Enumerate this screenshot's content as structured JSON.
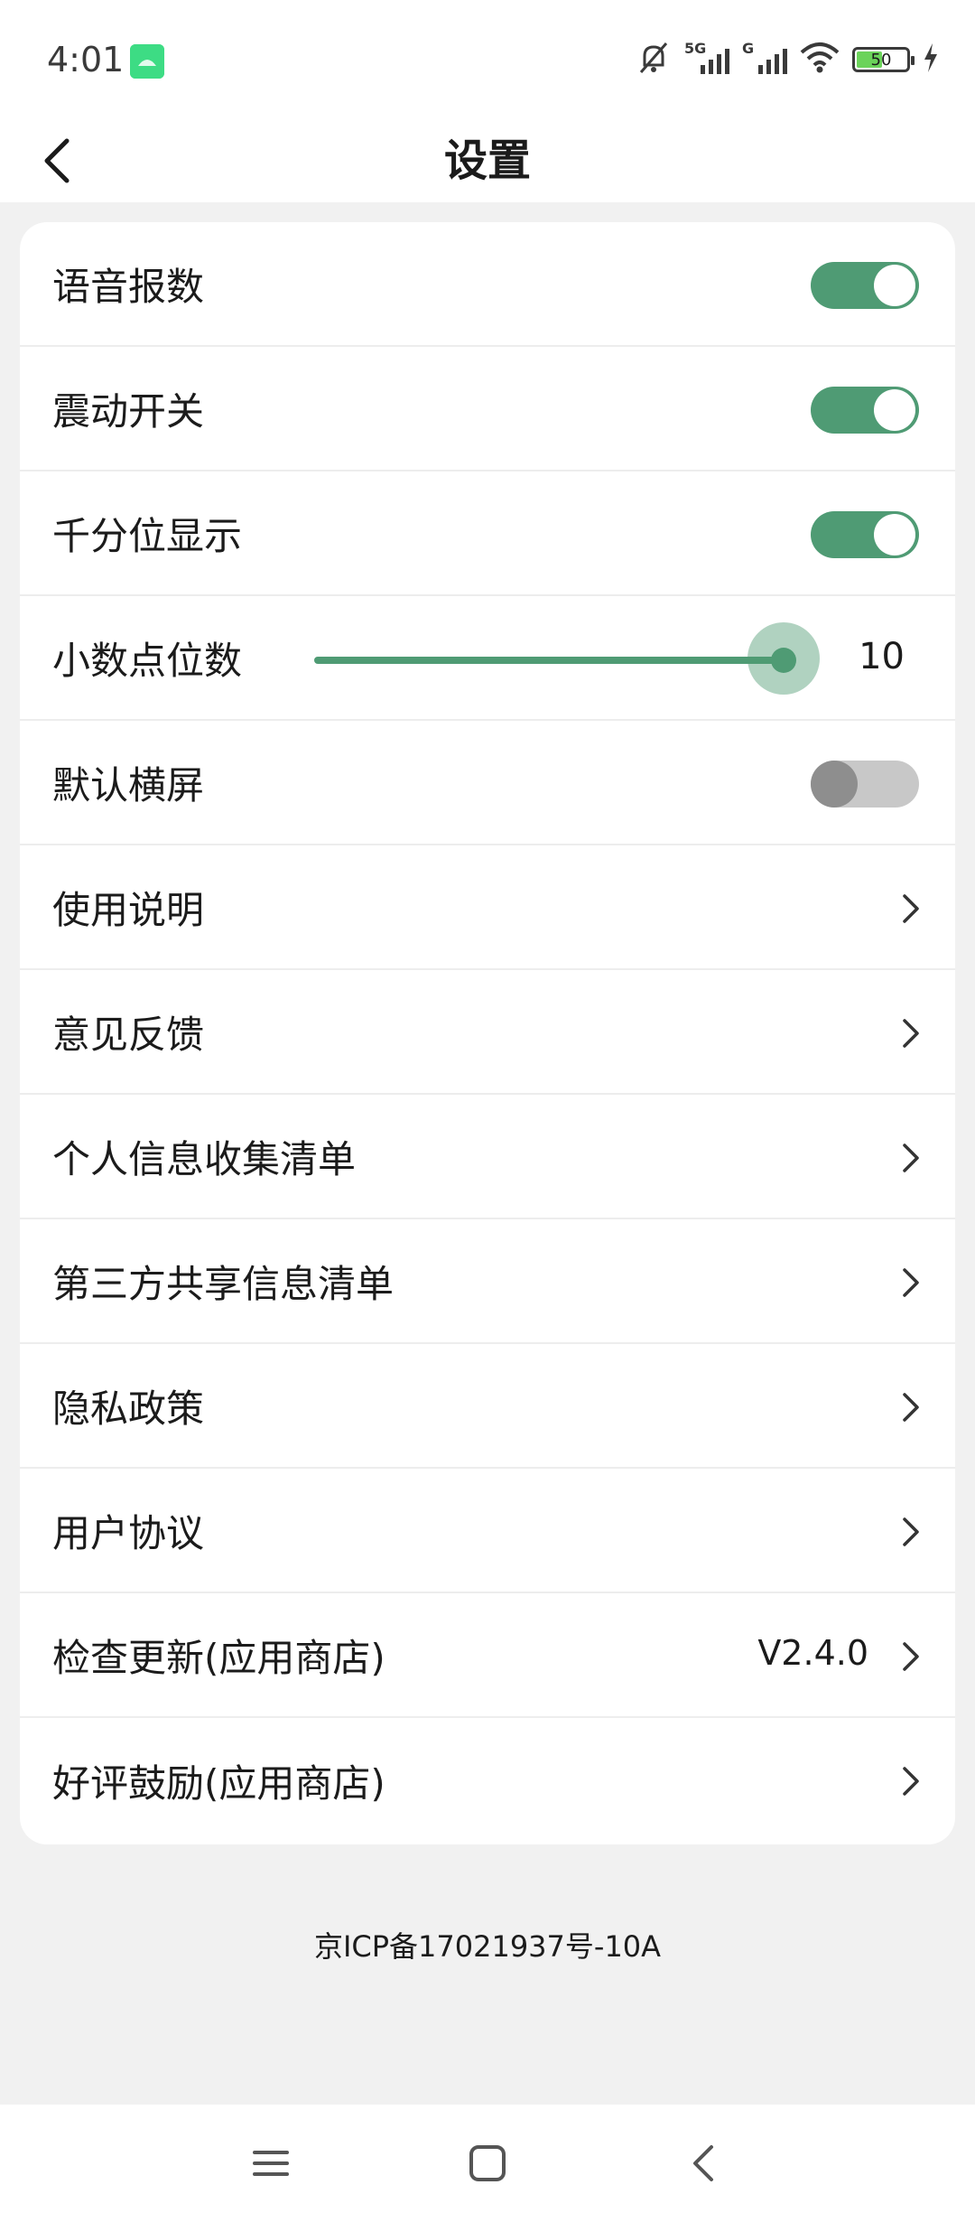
{
  "status_bar": {
    "time": "4:01",
    "signal_1_label": "5G",
    "signal_2_label": "G",
    "battery_level": "50",
    "icons": [
      "android-app-icon",
      "mute-icon",
      "signal-icon",
      "wifi-icon",
      "battery-icon",
      "charging-icon"
    ]
  },
  "header": {
    "title": "设置",
    "back_icon": "back-arrow-icon"
  },
  "settings": {
    "voice_broadcast": {
      "label": "语音报数",
      "on": true
    },
    "vibration": {
      "label": "震动开关",
      "on": true
    },
    "thousands_separator": {
      "label": "千分位显示",
      "on": true
    },
    "decimal_places": {
      "label": "小数点位数",
      "value": "10",
      "slider_fraction": 1.0
    },
    "default_landscape": {
      "label": "默认横屏",
      "on": false
    },
    "instructions": {
      "label": "使用说明"
    },
    "feedback": {
      "label": "意见反馈"
    },
    "personal_info_list": {
      "label": "个人信息收集清单"
    },
    "third_party_list": {
      "label": "第三方共享信息清单"
    },
    "privacy_policy": {
      "label": "隐私政策"
    },
    "user_agreement": {
      "label": "用户协议"
    },
    "check_update": {
      "label": "检查更新(应用商店)",
      "version": "V2.4.0"
    },
    "rate_us": {
      "label": "好评鼓励(应用商店)"
    }
  },
  "footer": {
    "icp": "京ICP备17021937号-10A"
  },
  "colors": {
    "accent": "#4f9b74",
    "toggle_off_track": "#c8c8c8",
    "toggle_off_knob": "#8e8e8e",
    "background": "#f1f1f1"
  },
  "nav_bar": {
    "icons": [
      "menu-icon",
      "home-icon",
      "back-icon"
    ]
  }
}
